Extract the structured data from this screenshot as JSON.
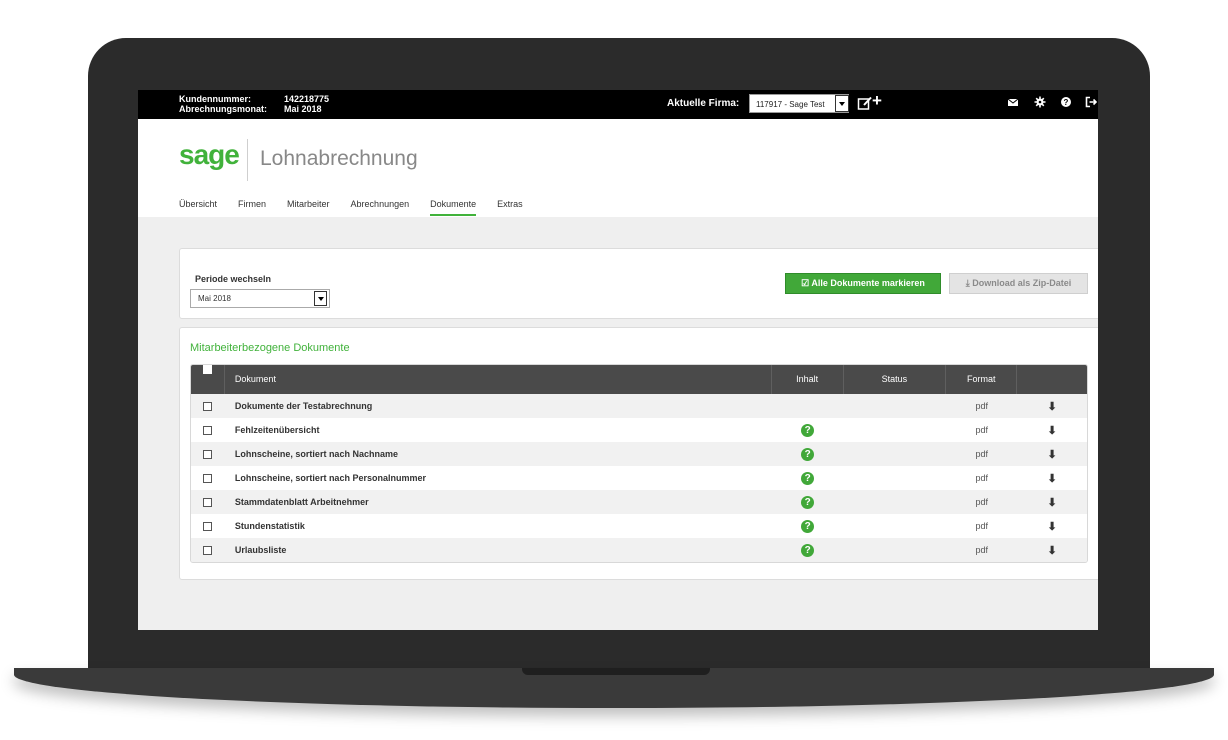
{
  "topbar": {
    "customer_label": "Kundennummer:",
    "customer_value": "142218775",
    "month_label": "Abrechnungsmonat:",
    "month_value": "Mai 2018",
    "firma_label": "Aktuelle Firma:",
    "firma_value": "117917 - Sage Test",
    "icons": [
      "edit-icon",
      "plus-icon",
      "mail-icon",
      "settings-icon",
      "help-icon",
      "logout-icon"
    ]
  },
  "header": {
    "logo": "sage",
    "product": "Lohnabrechnung",
    "nav": [
      "Übersicht",
      "Firmen",
      "Mitarbeiter",
      "Abrechnungen",
      "Dokumente",
      "Extras"
    ],
    "active_nav": "Dokumente"
  },
  "period": {
    "label": "Periode wechseln",
    "value": "Mai 2018"
  },
  "actions": {
    "mark_all": "Alle Dokumente markieren",
    "download_zip": "Download als Zip-Datei"
  },
  "documents": {
    "title": "Mitarbeiterbezogene Dokumente",
    "columns": [
      "Dokument",
      "Inhalt",
      "Status",
      "Format"
    ],
    "rows": [
      {
        "name": "Dokumente der Testabrechnung",
        "format": "pdf"
      },
      {
        "name": "Fehlzeitenübersicht",
        "format": "pdf"
      },
      {
        "name": "Lohnscheine, sortiert nach Nachname",
        "format": "pdf"
      },
      {
        "name": "Lohnscheine, sortiert nach Personalnummer",
        "format": "pdf"
      },
      {
        "name": "Stammdatenblatt Arbeitnehmer",
        "format": "pdf"
      },
      {
        "name": "Stundenstatistik",
        "format": "pdf"
      },
      {
        "name": "Urlaubsliste",
        "format": "pdf"
      }
    ]
  },
  "colors": {
    "accent": "#41b23b",
    "topbar": "#000000",
    "table_header": "#4a4a4a"
  }
}
